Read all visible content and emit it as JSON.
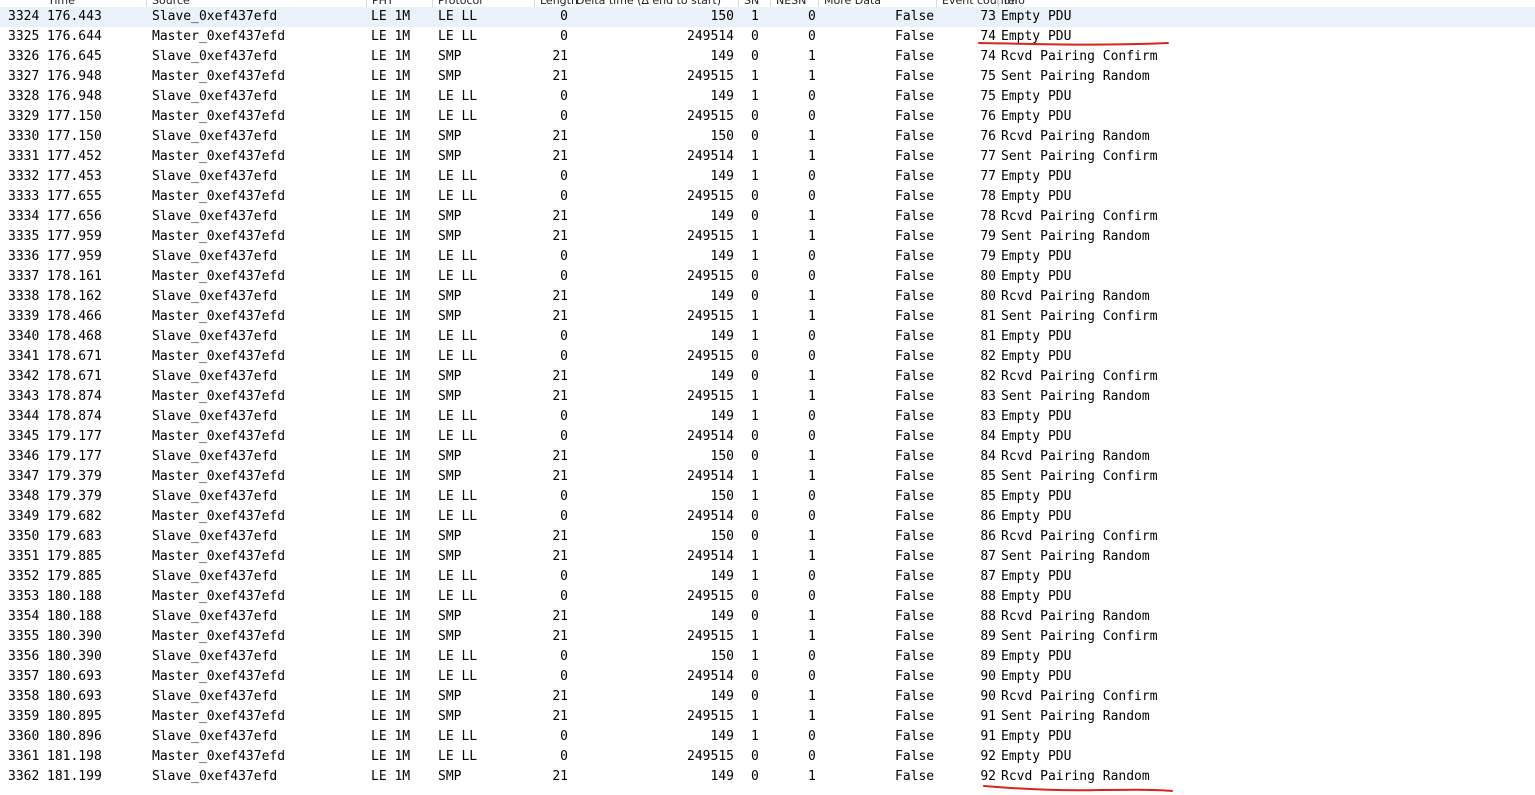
{
  "columns": [
    "No.",
    "Time",
    "Source",
    "PHY",
    "Protocol",
    "Length",
    "Delta time (∆ end to start)",
    "SN",
    "NESN",
    "More Data",
    "Event counter",
    "Info"
  ],
  "annotation_color": "#e0201b",
  "selected_row_color": "#e9f1fb",
  "rows": [
    {
      "no": "3324",
      "time": "176.443",
      "source": "Slave_0xef437efd",
      "phy": "LE 1M",
      "protocol": "LE LL",
      "length": "0",
      "delta": "150",
      "sn": "1",
      "nesn": "0",
      "more": "False",
      "event": "73",
      "info": "Empty PDU"
    },
    {
      "no": "3325",
      "time": "176.644",
      "source": "Master_0xef437efd",
      "phy": "LE 1M",
      "protocol": "LE LL",
      "length": "0",
      "delta": "249514",
      "sn": "0",
      "nesn": "0",
      "more": "False",
      "event": "74",
      "info": "Empty PDU"
    },
    {
      "no": "3326",
      "time": "176.645",
      "source": "Slave_0xef437efd",
      "phy": "LE 1M",
      "protocol": "SMP",
      "length": "21",
      "delta": "149",
      "sn": "0",
      "nesn": "1",
      "more": "False",
      "event": "74",
      "info": "Rcvd Pairing Confirm"
    },
    {
      "no": "3327",
      "time": "176.948",
      "source": "Master_0xef437efd",
      "phy": "LE 1M",
      "protocol": "SMP",
      "length": "21",
      "delta": "249515",
      "sn": "1",
      "nesn": "1",
      "more": "False",
      "event": "75",
      "info": "Sent Pairing Random"
    },
    {
      "no": "3328",
      "time": "176.948",
      "source": "Slave_0xef437efd",
      "phy": "LE 1M",
      "protocol": "LE LL",
      "length": "0",
      "delta": "149",
      "sn": "1",
      "nesn": "0",
      "more": "False",
      "event": "75",
      "info": "Empty PDU"
    },
    {
      "no": "3329",
      "time": "177.150",
      "source": "Master_0xef437efd",
      "phy": "LE 1M",
      "protocol": "LE LL",
      "length": "0",
      "delta": "249515",
      "sn": "0",
      "nesn": "0",
      "more": "False",
      "event": "76",
      "info": "Empty PDU"
    },
    {
      "no": "3330",
      "time": "177.150",
      "source": "Slave_0xef437efd",
      "phy": "LE 1M",
      "protocol": "SMP",
      "length": "21",
      "delta": "150",
      "sn": "0",
      "nesn": "1",
      "more": "False",
      "event": "76",
      "info": "Rcvd Pairing Random"
    },
    {
      "no": "3331",
      "time": "177.452",
      "source": "Master_0xef437efd",
      "phy": "LE 1M",
      "protocol": "SMP",
      "length": "21",
      "delta": "249514",
      "sn": "1",
      "nesn": "1",
      "more": "False",
      "event": "77",
      "info": "Sent Pairing Confirm"
    },
    {
      "no": "3332",
      "time": "177.453",
      "source": "Slave_0xef437efd",
      "phy": "LE 1M",
      "protocol": "LE LL",
      "length": "0",
      "delta": "149",
      "sn": "1",
      "nesn": "0",
      "more": "False",
      "event": "77",
      "info": "Empty PDU"
    },
    {
      "no": "3333",
      "time": "177.655",
      "source": "Master_0xef437efd",
      "phy": "LE 1M",
      "protocol": "LE LL",
      "length": "0",
      "delta": "249515",
      "sn": "0",
      "nesn": "0",
      "more": "False",
      "event": "78",
      "info": "Empty PDU"
    },
    {
      "no": "3334",
      "time": "177.656",
      "source": "Slave_0xef437efd",
      "phy": "LE 1M",
      "protocol": "SMP",
      "length": "21",
      "delta": "149",
      "sn": "0",
      "nesn": "1",
      "more": "False",
      "event": "78",
      "info": "Rcvd Pairing Confirm"
    },
    {
      "no": "3335",
      "time": "177.959",
      "source": "Master_0xef437efd",
      "phy": "LE 1M",
      "protocol": "SMP",
      "length": "21",
      "delta": "249515",
      "sn": "1",
      "nesn": "1",
      "more": "False",
      "event": "79",
      "info": "Sent Pairing Random"
    },
    {
      "no": "3336",
      "time": "177.959",
      "source": "Slave_0xef437efd",
      "phy": "LE 1M",
      "protocol": "LE LL",
      "length": "0",
      "delta": "149",
      "sn": "1",
      "nesn": "0",
      "more": "False",
      "event": "79",
      "info": "Empty PDU"
    },
    {
      "no": "3337",
      "time": "178.161",
      "source": "Master_0xef437efd",
      "phy": "LE 1M",
      "protocol": "LE LL",
      "length": "0",
      "delta": "249515",
      "sn": "0",
      "nesn": "0",
      "more": "False",
      "event": "80",
      "info": "Empty PDU"
    },
    {
      "no": "3338",
      "time": "178.162",
      "source": "Slave_0xef437efd",
      "phy": "LE 1M",
      "protocol": "SMP",
      "length": "21",
      "delta": "149",
      "sn": "0",
      "nesn": "1",
      "more": "False",
      "event": "80",
      "info": "Rcvd Pairing Random"
    },
    {
      "no": "3339",
      "time": "178.466",
      "source": "Master_0xef437efd",
      "phy": "LE 1M",
      "protocol": "SMP",
      "length": "21",
      "delta": "249515",
      "sn": "1",
      "nesn": "1",
      "more": "False",
      "event": "81",
      "info": "Sent Pairing Confirm"
    },
    {
      "no": "3340",
      "time": "178.468",
      "source": "Slave_0xef437efd",
      "phy": "LE 1M",
      "protocol": "LE LL",
      "length": "0",
      "delta": "149",
      "sn": "1",
      "nesn": "0",
      "more": "False",
      "event": "81",
      "info": "Empty PDU"
    },
    {
      "no": "3341",
      "time": "178.671",
      "source": "Master_0xef437efd",
      "phy": "LE 1M",
      "protocol": "LE LL",
      "length": "0",
      "delta": "249515",
      "sn": "0",
      "nesn": "0",
      "more": "False",
      "event": "82",
      "info": "Empty PDU"
    },
    {
      "no": "3342",
      "time": "178.671",
      "source": "Slave_0xef437efd",
      "phy": "LE 1M",
      "protocol": "SMP",
      "length": "21",
      "delta": "149",
      "sn": "0",
      "nesn": "1",
      "more": "False",
      "event": "82",
      "info": "Rcvd Pairing Confirm"
    },
    {
      "no": "3343",
      "time": "178.874",
      "source": "Master_0xef437efd",
      "phy": "LE 1M",
      "protocol": "SMP",
      "length": "21",
      "delta": "249515",
      "sn": "1",
      "nesn": "1",
      "more": "False",
      "event": "83",
      "info": "Sent Pairing Random"
    },
    {
      "no": "3344",
      "time": "178.874",
      "source": "Slave_0xef437efd",
      "phy": "LE 1M",
      "protocol": "LE LL",
      "length": "0",
      "delta": "149",
      "sn": "1",
      "nesn": "0",
      "more": "False",
      "event": "83",
      "info": "Empty PDU"
    },
    {
      "no": "3345",
      "time": "179.177",
      "source": "Master_0xef437efd",
      "phy": "LE 1M",
      "protocol": "LE LL",
      "length": "0",
      "delta": "249514",
      "sn": "0",
      "nesn": "0",
      "more": "False",
      "event": "84",
      "info": "Empty PDU"
    },
    {
      "no": "3346",
      "time": "179.177",
      "source": "Slave_0xef437efd",
      "phy": "LE 1M",
      "protocol": "SMP",
      "length": "21",
      "delta": "150",
      "sn": "0",
      "nesn": "1",
      "more": "False",
      "event": "84",
      "info": "Rcvd Pairing Random"
    },
    {
      "no": "3347",
      "time": "179.379",
      "source": "Master_0xef437efd",
      "phy": "LE 1M",
      "protocol": "SMP",
      "length": "21",
      "delta": "249514",
      "sn": "1",
      "nesn": "1",
      "more": "False",
      "event": "85",
      "info": "Sent Pairing Confirm"
    },
    {
      "no": "3348",
      "time": "179.379",
      "source": "Slave_0xef437efd",
      "phy": "LE 1M",
      "protocol": "LE LL",
      "length": "0",
      "delta": "150",
      "sn": "1",
      "nesn": "0",
      "more": "False",
      "event": "85",
      "info": "Empty PDU"
    },
    {
      "no": "3349",
      "time": "179.682",
      "source": "Master_0xef437efd",
      "phy": "LE 1M",
      "protocol": "LE LL",
      "length": "0",
      "delta": "249514",
      "sn": "0",
      "nesn": "0",
      "more": "False",
      "event": "86",
      "info": "Empty PDU"
    },
    {
      "no": "3350",
      "time": "179.683",
      "source": "Slave_0xef437efd",
      "phy": "LE 1M",
      "protocol": "SMP",
      "length": "21",
      "delta": "150",
      "sn": "0",
      "nesn": "1",
      "more": "False",
      "event": "86",
      "info": "Rcvd Pairing Confirm"
    },
    {
      "no": "3351",
      "time": "179.885",
      "source": "Master_0xef437efd",
      "phy": "LE 1M",
      "protocol": "SMP",
      "length": "21",
      "delta": "249514",
      "sn": "1",
      "nesn": "1",
      "more": "False",
      "event": "87",
      "info": "Sent Pairing Random"
    },
    {
      "no": "3352",
      "time": "179.885",
      "source": "Slave_0xef437efd",
      "phy": "LE 1M",
      "protocol": "LE LL",
      "length": "0",
      "delta": "149",
      "sn": "1",
      "nesn": "0",
      "more": "False",
      "event": "87",
      "info": "Empty PDU"
    },
    {
      "no": "3353",
      "time": "180.188",
      "source": "Master_0xef437efd",
      "phy": "LE 1M",
      "protocol": "LE LL",
      "length": "0",
      "delta": "249515",
      "sn": "0",
      "nesn": "0",
      "more": "False",
      "event": "88",
      "info": "Empty PDU"
    },
    {
      "no": "3354",
      "time": "180.188",
      "source": "Slave_0xef437efd",
      "phy": "LE 1M",
      "protocol": "SMP",
      "length": "21",
      "delta": "149",
      "sn": "0",
      "nesn": "1",
      "more": "False",
      "event": "88",
      "info": "Rcvd Pairing Random"
    },
    {
      "no": "3355",
      "time": "180.390",
      "source": "Master_0xef437efd",
      "phy": "LE 1M",
      "protocol": "SMP",
      "length": "21",
      "delta": "249515",
      "sn": "1",
      "nesn": "1",
      "more": "False",
      "event": "89",
      "info": "Sent Pairing Confirm"
    },
    {
      "no": "3356",
      "time": "180.390",
      "source": "Slave_0xef437efd",
      "phy": "LE 1M",
      "protocol": "LE LL",
      "length": "0",
      "delta": "150",
      "sn": "1",
      "nesn": "0",
      "more": "False",
      "event": "89",
      "info": "Empty PDU"
    },
    {
      "no": "3357",
      "time": "180.693",
      "source": "Master_0xef437efd",
      "phy": "LE 1M",
      "protocol": "LE LL",
      "length": "0",
      "delta": "249514",
      "sn": "0",
      "nesn": "0",
      "more": "False",
      "event": "90",
      "info": "Empty PDU"
    },
    {
      "no": "3358",
      "time": "180.693",
      "source": "Slave_0xef437efd",
      "phy": "LE 1M",
      "protocol": "SMP",
      "length": "21",
      "delta": "149",
      "sn": "0",
      "nesn": "1",
      "more": "False",
      "event": "90",
      "info": "Rcvd Pairing Confirm"
    },
    {
      "no": "3359",
      "time": "180.895",
      "source": "Master_0xef437efd",
      "phy": "LE 1M",
      "protocol": "SMP",
      "length": "21",
      "delta": "249515",
      "sn": "1",
      "nesn": "1",
      "more": "False",
      "event": "91",
      "info": "Sent Pairing Random"
    },
    {
      "no": "3360",
      "time": "180.896",
      "source": "Slave_0xef437efd",
      "phy": "LE 1M",
      "protocol": "LE LL",
      "length": "0",
      "delta": "149",
      "sn": "1",
      "nesn": "0",
      "more": "False",
      "event": "91",
      "info": "Empty PDU"
    },
    {
      "no": "3361",
      "time": "181.198",
      "source": "Master_0xef437efd",
      "phy": "LE 1M",
      "protocol": "LE LL",
      "length": "0",
      "delta": "249515",
      "sn": "0",
      "nesn": "0",
      "more": "False",
      "event": "92",
      "info": "Empty PDU"
    },
    {
      "no": "3362",
      "time": "181.199",
      "source": "Slave_0xef437efd",
      "phy": "LE 1M",
      "protocol": "SMP",
      "length": "21",
      "delta": "149",
      "sn": "0",
      "nesn": "1",
      "more": "False",
      "event": "92",
      "info": "Rcvd Pairing Random"
    }
  ]
}
